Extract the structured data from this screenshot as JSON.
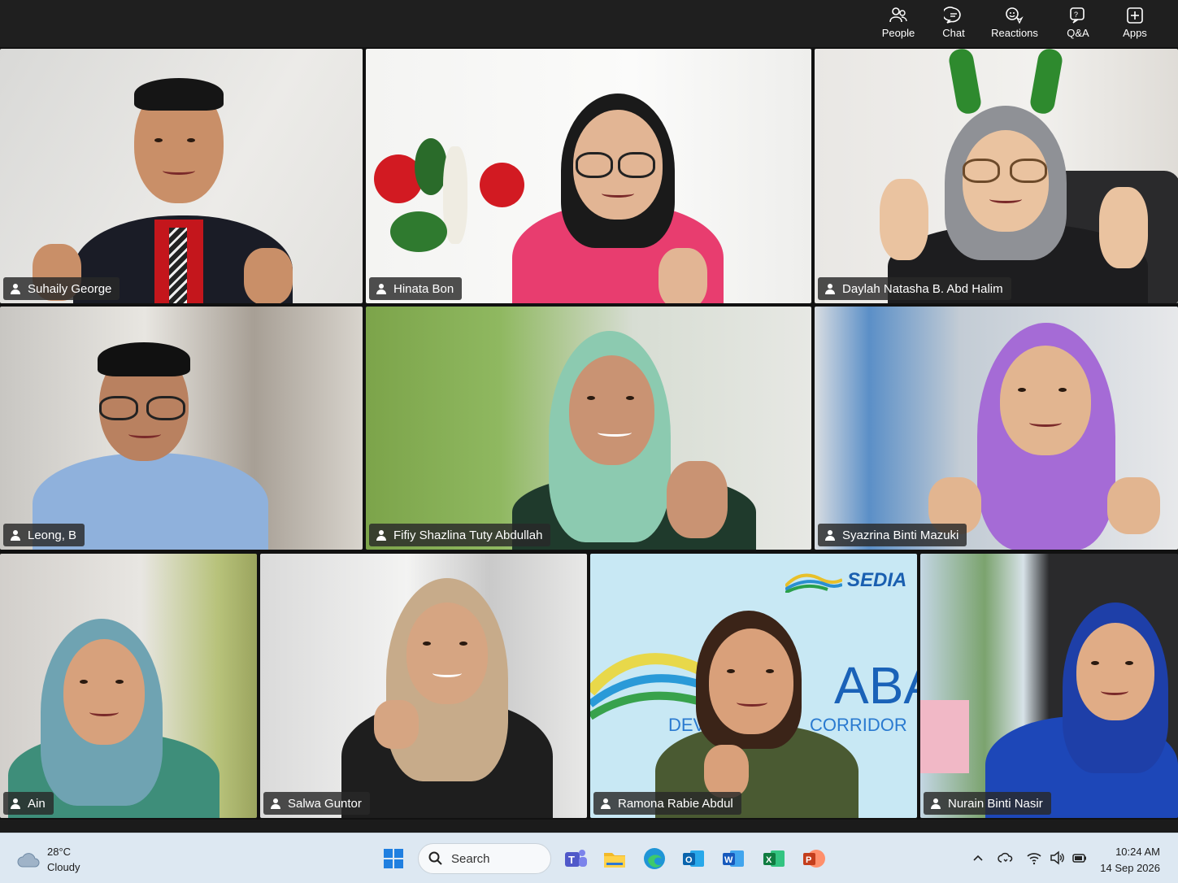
{
  "toolbar": {
    "people": "People",
    "chat": "Chat",
    "reactions": "Reactions",
    "qa": "Q&A",
    "apps": "Apps"
  },
  "participants": [
    {
      "name": "Suhaily George"
    },
    {
      "name": "Hinata Bon"
    },
    {
      "name": "Daylah Natasha B. Abd Halim"
    },
    {
      "name": "Leong, B"
    },
    {
      "name": "Fifiy Shazlina Tuty Abdullah"
    },
    {
      "name": "Syazrina Binti Mazuki"
    },
    {
      "name": "Ain"
    },
    {
      "name": "Salwa Guntor"
    },
    {
      "name": "Ramona Rabie Abdul"
    },
    {
      "name": "Nurain Binti Nasir"
    }
  ],
  "backdrop": {
    "logo_text": "SEDIA",
    "banner_big": "ABAH",
    "banner_dev": "DEV",
    "banner_corridor": "CORRIDOR"
  },
  "taskbar": {
    "weather_temp": "28°C",
    "weather_desc": "Cloudy",
    "search_placeholder": "Search",
    "time": "10:24 AM",
    "date": "14 Sep 2026"
  }
}
